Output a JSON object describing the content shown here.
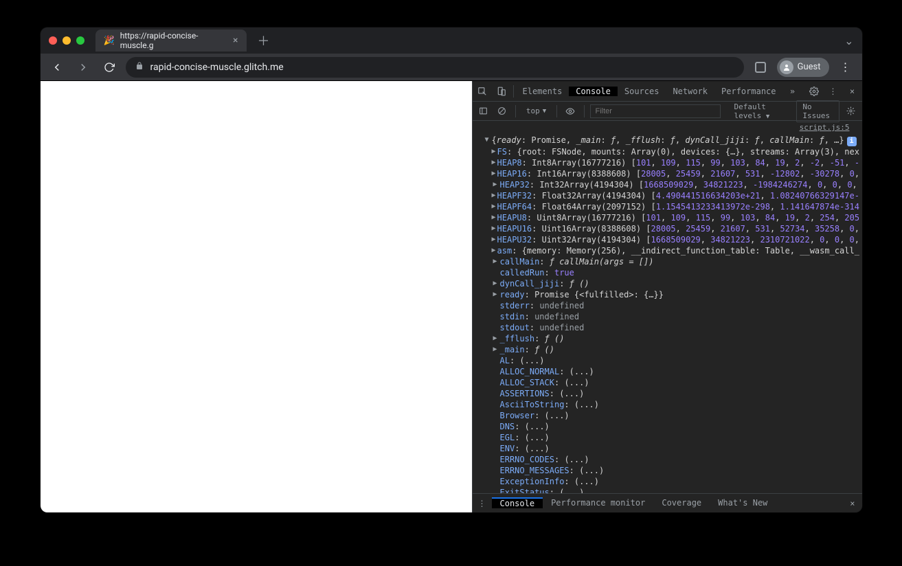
{
  "browser": {
    "tab_title": "https://rapid-concise-muscle.g",
    "favicon": "🎉",
    "url_display": "rapid-concise-muscle.glitch.me",
    "guest_label": "Guest"
  },
  "devtools": {
    "tabs": [
      "Elements",
      "Console",
      "Sources",
      "Network",
      "Performance"
    ],
    "active_tab": "Console",
    "console_toolbar": {
      "context": "top",
      "filter_placeholder": "Filter",
      "levels": "Default levels",
      "issues": "No Issues"
    },
    "source_link": "script.js:5",
    "drawer_tabs": [
      "Console",
      "Performance monitor",
      "Coverage",
      "What's New"
    ],
    "active_drawer": "Console"
  },
  "log": {
    "toprow": {
      "props": [
        {
          "k": "ready",
          "v": "Promise"
        },
        {
          "k": " _main",
          "v": "ƒ"
        },
        {
          "k": " _fflush",
          "v": "ƒ"
        },
        {
          "k": " dynCall_jiji",
          "v": "ƒ"
        },
        {
          "k": " callMain",
          "v": "ƒ"
        }
      ],
      "trailer": ", …}"
    },
    "entries": [
      {
        "key": "FS",
        "type": "obj",
        "inline": "{root: FSNode, mounts: Array(0), devices: {…}, streams: Array(3), nex"
      },
      {
        "key": "HEAP8",
        "type": "arr",
        "proto": "Int8Array(16777216)",
        "values": [
          "101",
          "109",
          "115",
          "99",
          "103",
          "84",
          "19",
          "2",
          "-2",
          "-51",
          "-"
        ]
      },
      {
        "key": "HEAP16",
        "type": "arr",
        "proto": "Int16Array(8388608)",
        "values": [
          "28005",
          "25459",
          "21607",
          "531",
          "-12802",
          "-30278",
          "0",
          ""
        ]
      },
      {
        "key": "HEAP32",
        "type": "arr",
        "proto": "Int32Array(4194304)",
        "values": [
          "1668509029",
          "34821223",
          "-1984246274",
          "0",
          "0",
          "0",
          ""
        ]
      },
      {
        "key": "HEAPF32",
        "type": "arr",
        "proto": "Float32Array(4194304)",
        "values": [
          "4.490441516634203e+21",
          "1.08240766329147e-"
        ]
      },
      {
        "key": "HEAPF64",
        "type": "arr",
        "proto": "Float64Array(2097152)",
        "values": [
          "1.1545413233413972e-298",
          "1.141647874e-314"
        ]
      },
      {
        "key": "HEAPU8",
        "type": "arr",
        "proto": "Uint8Array(16777216)",
        "values": [
          "101",
          "109",
          "115",
          "99",
          "103",
          "84",
          "19",
          "2",
          "254",
          "205"
        ]
      },
      {
        "key": "HEAPU16",
        "type": "arr",
        "proto": "Uint16Array(8388608)",
        "values": [
          "28005",
          "25459",
          "21607",
          "531",
          "52734",
          "35258",
          "0",
          ""
        ]
      },
      {
        "key": "HEAPU32",
        "type": "arr",
        "proto": "Uint32Array(4194304)",
        "values": [
          "1668509029",
          "34821223",
          "2310721022",
          "0",
          "0",
          "0",
          ""
        ]
      },
      {
        "key": "asm",
        "type": "obj",
        "inline": "{memory: Memory(256), __indirect_function_table: Table, __wasm_call_"
      },
      {
        "key": "callMain",
        "type": "fn",
        "sig": "ƒ callMain(args = [])"
      },
      {
        "key": "calledRun",
        "type": "bool",
        "value": "true"
      },
      {
        "key": "dynCall_jiji",
        "type": "fn",
        "sig": "ƒ ()"
      },
      {
        "key": "ready",
        "type": "promise",
        "inline": "Promise {<fulfilled>: {…}}"
      },
      {
        "key": "stderr",
        "type": "undef"
      },
      {
        "key": "stdin",
        "type": "undef"
      },
      {
        "key": "stdout",
        "type": "undef"
      },
      {
        "key": "_fflush",
        "type": "fn",
        "sig": "ƒ ()"
      },
      {
        "key": "_main",
        "type": "fn",
        "sig": "ƒ ()"
      },
      {
        "key": "AL",
        "type": "getter"
      },
      {
        "key": "ALLOC_NORMAL",
        "type": "getter"
      },
      {
        "key": "ALLOC_STACK",
        "type": "getter"
      },
      {
        "key": "ASSERTIONS",
        "type": "getter"
      },
      {
        "key": "AsciiToString",
        "type": "getter"
      },
      {
        "key": "Browser",
        "type": "getter"
      },
      {
        "key": "DNS",
        "type": "getter"
      },
      {
        "key": "EGL",
        "type": "getter"
      },
      {
        "key": "ENV",
        "type": "getter"
      },
      {
        "key": "ERRNO_CODES",
        "type": "getter"
      },
      {
        "key": "ERRNO_MESSAGES",
        "type": "getter"
      },
      {
        "key": "ExceptionInfo",
        "type": "getter"
      },
      {
        "key": "ExitStatus",
        "type": "getter"
      }
    ]
  }
}
